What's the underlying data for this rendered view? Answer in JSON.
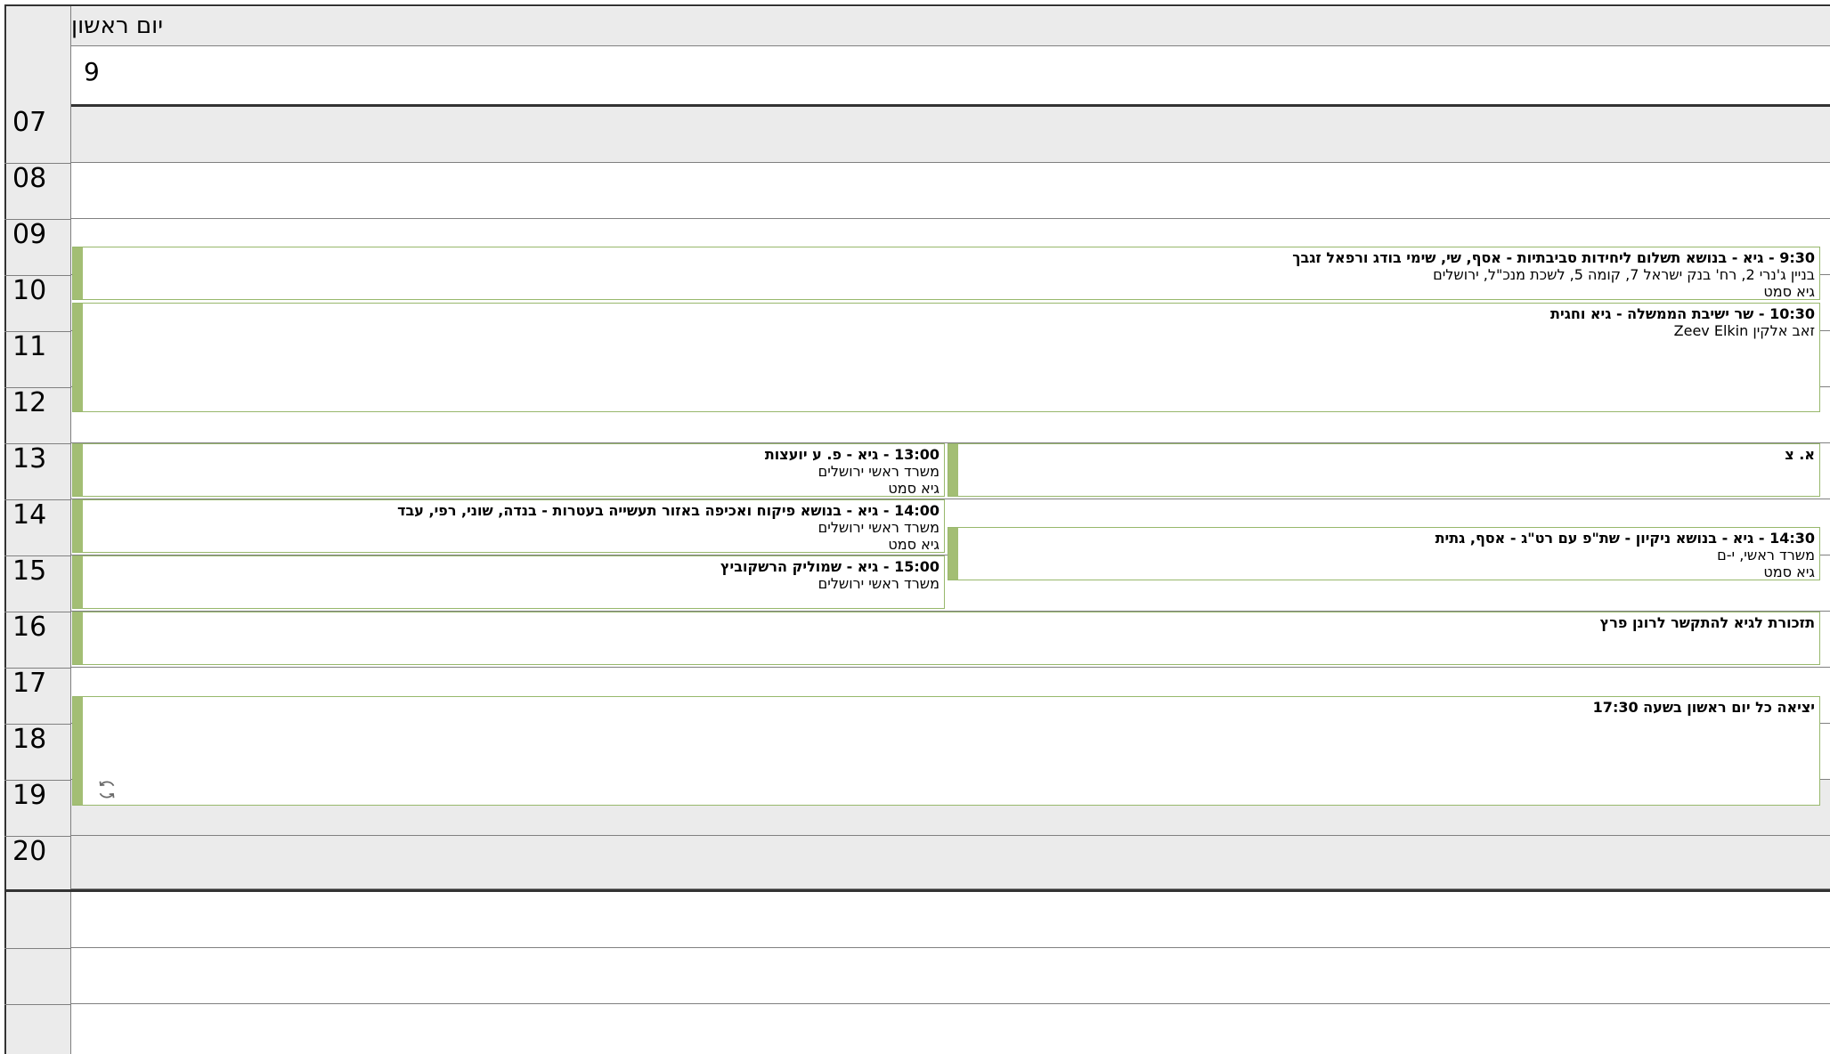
{
  "day": {
    "name": "יום ראשון",
    "number": "9"
  },
  "hours": [
    "07",
    "08",
    "09",
    "10",
    "11",
    "12",
    "13",
    "14",
    "15",
    "16",
    "17",
    "18",
    "19",
    "20"
  ],
  "events": {
    "e1": {
      "title": "9:30 - גיא - בנושא תשלום ליחידות סביבתיות - אסף, שי, שימי בודג ורפאל זגבך",
      "location": "בניין ג'נרי 2, רח' בנק ישראל 7, קומה 5, לשכת מנכ\"ל, ירושלים",
      "organizer": "גיא סמט"
    },
    "e2": {
      "title": "10:30 - שר  ישיבת הממשלה - גיא וחגית",
      "location": "זאב אלקין   Zeev Elkin"
    },
    "e3": {
      "title": "13:00 - גיא - פ. ע יועצות",
      "location": "משרד ראשי ירושלים",
      "organizer": "גיא סמט"
    },
    "e4": {
      "title": "א. צ"
    },
    "e5": {
      "title": "14:00 - גיא - בנושא פיקוח ואכיפה באזור תעשייה בעטרות - בנדה, שוני, רפי, עבד",
      "location": "משרד ראשי ירושלים",
      "organizer": "גיא סמט"
    },
    "e6": {
      "title": "14:30 - גיא - בנושא ניקיון - שת\"פ עם רט\"ג  - אסף, גתית",
      "location": "משרד ראשי, י-ם",
      "organizer": "גיא סמט"
    },
    "e7": {
      "title": "15:00 - גיא - שמוליק הרשקוביץ",
      "location": "משרד ראשי ירושלים"
    },
    "e8": {
      "title": "תזכורת לגיא להתקשר לרונן פרץ"
    },
    "e9": {
      "title": "יציאה כל יום ראשון בשעה 17:30",
      "icon": "recurring-icon"
    }
  },
  "colors": {
    "event_bar": "#a3be74",
    "event_border": "#98b86c",
    "off_hours": "#ebebeb",
    "grid_line": "#808080"
  }
}
